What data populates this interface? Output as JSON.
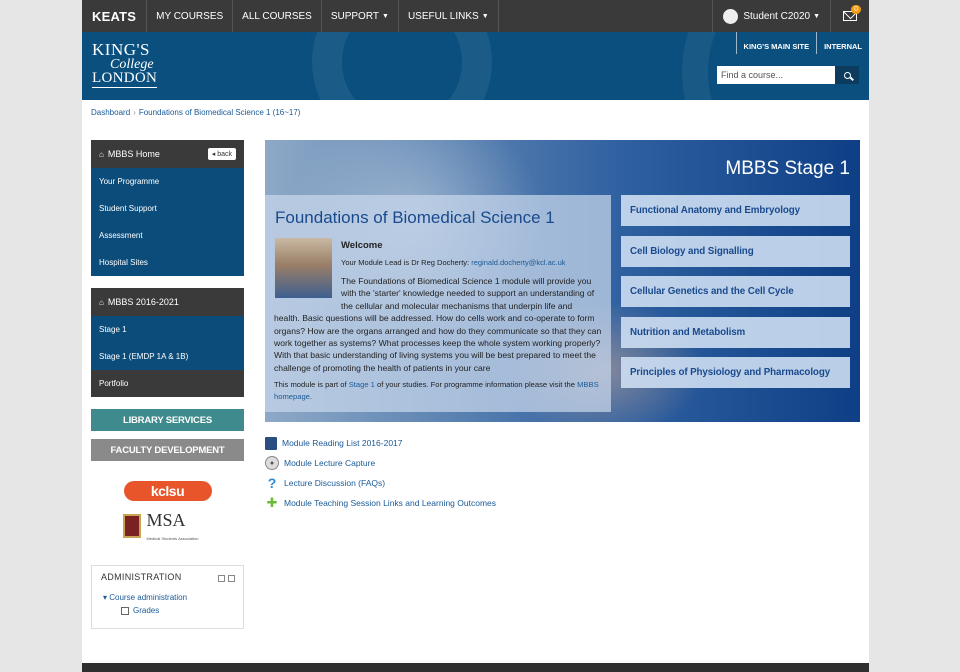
{
  "topnav": {
    "brand": "KEATS",
    "items": [
      "MY COURSES",
      "ALL COURSES",
      "SUPPORT",
      "USEFUL LINKS"
    ],
    "user": "Student C2020",
    "message_count": "0"
  },
  "banner": {
    "logo_line1": "KING'S",
    "logo_line2": "College",
    "logo_line3": "LONDON",
    "links": [
      "KING'S MAIN SITE",
      "INTERNAL"
    ],
    "search_placeholder": "Find a course..."
  },
  "breadcrumb": {
    "home": "Dashboard",
    "current": "Foundations of Biomedical Science 1 (16~17)"
  },
  "sidebar": {
    "home_label": "MBBS Home",
    "back_label": "back",
    "items": [
      "Your Programme",
      "Student Support",
      "Assessment",
      "Hospital Sites"
    ],
    "group_label": "MBBS 2016-2021",
    "group_items": [
      "Stage 1",
      "Stage 1 (EMDP 1A & 1B)",
      "Portfolio"
    ],
    "library_btn": "LIBRARY SERVICES",
    "faculty_btn": "FACULTY DEVELOPMENT",
    "kclsu_logo": "kclsu",
    "msa_logo": "MSA",
    "msa_sub": "Medical Students Association"
  },
  "admin": {
    "title": "ADMINISTRATION",
    "course_admin": "Course administration",
    "grades": "Grades"
  },
  "hero": {
    "stage_title": "MBBS Stage 1",
    "course_title": "Foundations of Biomedical Science 1",
    "welcome": "Welcome",
    "lead_prefix": "Your Module Lead is Dr Reg Docherty:",
    "lead_email": "reginald.docherty@kcl.ac.uk",
    "intro_1": "The Foundations of Biomedical Science 1 module will provide you with the 'starter' knowledge needed to support an understanding of the cellular and molecular mechanisms that underpin life and",
    "intro_2": "health. Basic questions will be addressed. How do cells work and co-operate to form organs? How are the organs arranged and how do they communicate so that they can work together as systems? What processes keep the whole system working properly? With that basic understanding of living systems you will be best prepared to meet the challenge of promoting the health of patients in your care",
    "foot_1": "This module is part of",
    "foot_link1": "Stage 1",
    "foot_2": "of your studies. For programme information please visit the",
    "foot_link2": "MBBS homepage",
    "foot_3": ".",
    "topics": [
      "Functional Anatomy and Embryology",
      "Cell Biology and Signalling",
      "Cellular Genetics and the Cell Cycle",
      "Nutrition and Metabolism",
      "Principles of Physiology and Pharmacology"
    ]
  },
  "activities": [
    "Module Reading List 2016-2017",
    "Module Lecture Capture",
    "Lecture Discussion (FAQs)",
    "Module Teaching Session Links and Learning Outcomes"
  ]
}
